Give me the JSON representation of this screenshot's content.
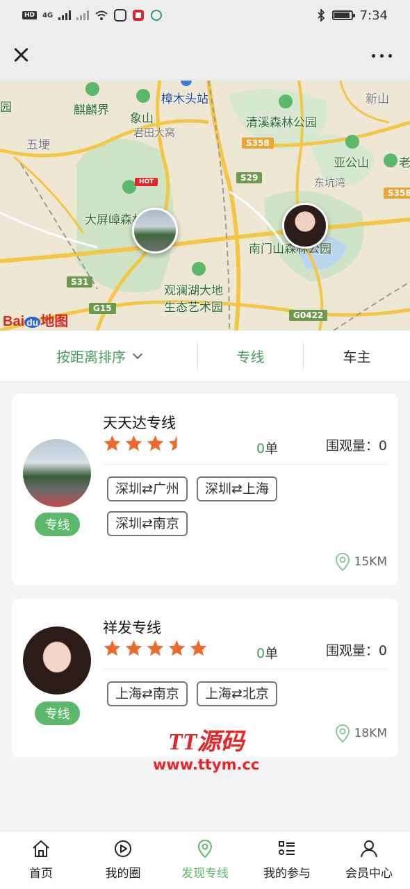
{
  "status_bar": {
    "network_badge": "HD",
    "network_gen": "4G",
    "time": "7:34"
  },
  "map": {
    "labels": [
      {
        "text": "园",
        "style": "green"
      },
      {
        "text": "麒麟界",
        "style": "green"
      },
      {
        "text": "象山",
        "style": "green"
      },
      {
        "text": "樟木头站",
        "style": "blue"
      },
      {
        "text": "新山",
        "style": "gray"
      },
      {
        "text": "五埂",
        "style": "gray"
      },
      {
        "text": "君田大窝",
        "style": "gray"
      },
      {
        "text": "清溪森林公园",
        "style": "green"
      },
      {
        "text": "亚公山",
        "style": "green"
      },
      {
        "text": "老",
        "style": "green"
      },
      {
        "text": "东坑湾",
        "style": "gray"
      },
      {
        "text": "大屏嶂森林公园",
        "style": "green"
      },
      {
        "text": "南门山森林公园",
        "style": "green"
      },
      {
        "text": "观澜湖大地",
        "style": "green"
      },
      {
        "text": "生态艺术园",
        "style": "green"
      }
    ],
    "road_tags": [
      {
        "text": "S358",
        "style": "orange"
      },
      {
        "text": "S29",
        "style": "green"
      },
      {
        "text": "S358",
        "style": "orange"
      },
      {
        "text": "S31",
        "style": "green"
      },
      {
        "text": "G15",
        "style": "green"
      },
      {
        "text": "G0422",
        "style": "green"
      }
    ],
    "hot_tag": "HOT",
    "logo_text": "Bai",
    "logo_badge": "du",
    "logo_suffix": "地图"
  },
  "filters": {
    "sort_label": "按距离排序",
    "line_label": "专线",
    "owner_label": "车主"
  },
  "cards": [
    {
      "title": "天天达专线",
      "badge": "专线",
      "rating": 3.5,
      "orders_count": "0",
      "orders_unit": "单",
      "views_label": "围观量：",
      "views_value": "0",
      "routes": [
        "深圳⇄广州",
        "深圳⇄上海",
        "深圳⇄南京"
      ],
      "distance": "15KM"
    },
    {
      "title": "祥发专线",
      "badge": "专线",
      "rating": 5,
      "orders_count": "0",
      "orders_unit": "单",
      "views_label": "围观量：",
      "views_value": "0",
      "routes": [
        "上海⇄南京",
        "上海⇄北京"
      ],
      "distance": "18KM"
    }
  ],
  "watermark": {
    "line1": "TT源码",
    "line2": "www.ttym.cc"
  },
  "tabbar": {
    "items": [
      {
        "label": "首页",
        "icon": "home-icon"
      },
      {
        "label": "我的圈",
        "icon": "circle-play-icon"
      },
      {
        "label": "发现专线",
        "icon": "location-pin-icon",
        "active": true
      },
      {
        "label": "我的参与",
        "icon": "list-icon"
      },
      {
        "label": "会员中心",
        "icon": "user-icon"
      }
    ]
  },
  "colors": {
    "accent": "#5cb86b",
    "accent_text": "#4b9a5a",
    "star": "#ee6a2b",
    "watermark": "#e4262a"
  }
}
